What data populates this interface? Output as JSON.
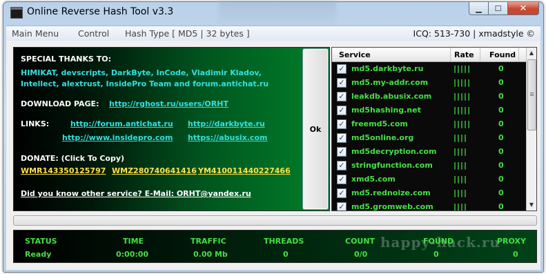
{
  "window": {
    "title": "Online Reverse Hash Tool v3.3"
  },
  "menu": {
    "items": [
      "Main Menu",
      "Control",
      "Hash Type [ MD5 | 32 bytes ]"
    ],
    "right_text": "ICQ: 513-730 | xmadstyle ©"
  },
  "info": {
    "thanks_heading": "SPECIAL THANKS TO:",
    "thanks_line1": "HIMIKAT, devscripts, DarkByte, InCode, Vladimir Kladov,",
    "thanks_line2": "Intellect, alextrust, InsidePro Team and forum.antichat.ru",
    "download_label": "DOWNLOAD PAGE:",
    "download_link": "http://rghost.ru/users/ORHT",
    "links_label": "LINKS:",
    "links": [
      "http://forum.antichat.ru",
      "http://darkbyte.ru",
      "http://www.insidepro.com",
      "https://abusix.com"
    ],
    "donate_label": "DONATE: (Click To Copy)",
    "donate": [
      "WMR143350125797",
      "WMZ280740641416",
      "YM410011440227466"
    ],
    "contact": "Did you know other service? E-Mail: ORHT@yandex.ru"
  },
  "ok_button": "Ok",
  "services": {
    "columns": [
      "Service",
      "Rate",
      "Found"
    ],
    "rows": [
      {
        "name": "md5.darkbyte.ru",
        "rate": "|||||",
        "found": "0",
        "checked": true
      },
      {
        "name": "md5.my-addr.com",
        "rate": "|||||",
        "found": "0",
        "checked": true
      },
      {
        "name": "leakdb.abusix.com",
        "rate": "|||||",
        "found": "0",
        "checked": true
      },
      {
        "name": "md5hashing.net",
        "rate": "|||||",
        "found": "0",
        "checked": true
      },
      {
        "name": "freemd5.com",
        "rate": "|||||",
        "found": "0",
        "checked": true
      },
      {
        "name": "md5online.org",
        "rate": "||||",
        "found": "0",
        "checked": true
      },
      {
        "name": "md5decryption.com",
        "rate": "||||",
        "found": "0",
        "checked": true
      },
      {
        "name": "stringfunction.com",
        "rate": "||||",
        "found": "0",
        "checked": true
      },
      {
        "name": "xmd5.com",
        "rate": "||||",
        "found": "0",
        "checked": true
      },
      {
        "name": "md5.rednoize.com",
        "rate": "||||",
        "found": "0",
        "checked": true
      },
      {
        "name": "md5.gromweb.com",
        "rate": "||||",
        "found": "0",
        "checked": true
      }
    ],
    "check_glyph": "✓"
  },
  "status": {
    "headers": [
      "STATUS",
      "TIME",
      "TRAFFIC",
      "THREADS",
      "COUNT",
      "FOUND",
      "PROXY"
    ],
    "values": [
      "Ready",
      "0:00:00",
      "0.00 Mb",
      "0",
      "0/0",
      "0",
      "0"
    ],
    "watermark": "happy-hack.ru"
  },
  "colors": {
    "accent_green": "#45e045",
    "link_cyan": "#33e0e0",
    "donate_yellow": "#ffe14a",
    "close_red": "#c8472f"
  }
}
